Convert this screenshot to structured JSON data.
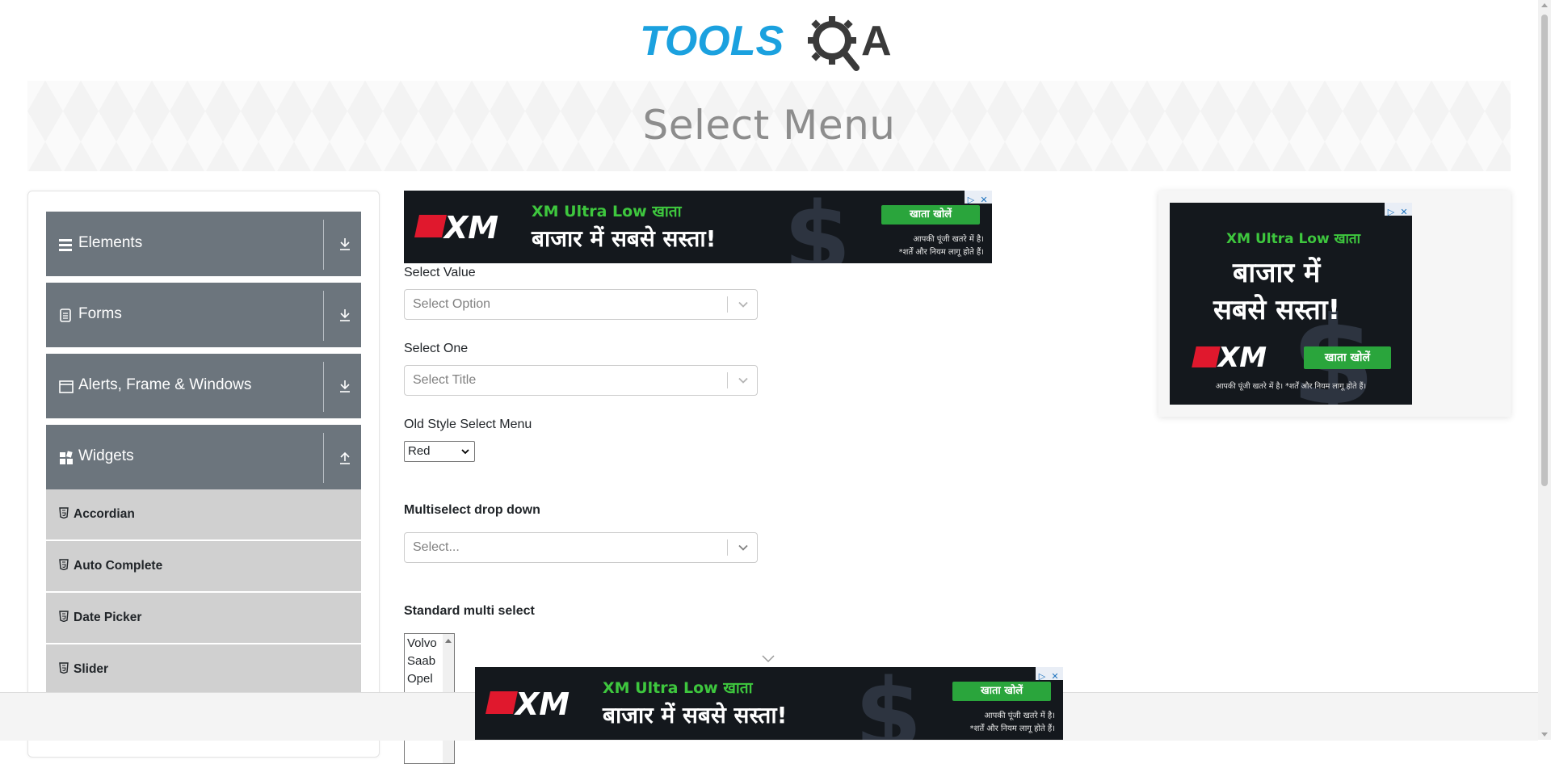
{
  "header": {
    "logo_text_left": "TOOLS",
    "logo_text_right": "A",
    "logo_icon": "gear-magnifier-q-icon"
  },
  "banner": {
    "title": "Select Menu"
  },
  "sidebar": {
    "groups": [
      {
        "label": "Elements",
        "icon": "hamburger-icon",
        "state": "collapsed"
      },
      {
        "label": "Forms",
        "icon": "form-icon",
        "state": "collapsed"
      },
      {
        "label": "Alerts, Frame & Windows",
        "icon": "window-icon",
        "state": "collapsed"
      },
      {
        "label": "Widgets",
        "icon": "widgets-icon",
        "state": "expanded"
      }
    ],
    "widget_items": [
      {
        "label": "Accordian"
      },
      {
        "label": "Auto Complete"
      },
      {
        "label": "Date Picker"
      },
      {
        "label": "Slider"
      }
    ]
  },
  "ads": {
    "brand": "XM",
    "headline": "XM Ultra Low खाता",
    "tagline": "बाजार में सबसे सस्ता!",
    "tagline_line1": "बाजार में",
    "tagline_line2": "सबसे सस्ता!",
    "cta": "खाता खोलें",
    "disclaimer1": "आपकी पूंजी खतरे में है।",
    "disclaimer2": "*शर्तें और नियम लागू होते हैं।",
    "disclaimer_single": "आपकी पूंजी खतरे में है। *शर्तें और नियम लागू होते हैं।",
    "chip_info": "▷",
    "chip_close": "✕"
  },
  "form": {
    "select_value": {
      "label": "Select Value",
      "placeholder": "Select Option"
    },
    "select_one": {
      "label": "Select One",
      "placeholder": "Select Title"
    },
    "old_style": {
      "label": "Old Style Select Menu",
      "selected": "Red"
    },
    "multiselect": {
      "label": "Multiselect drop down",
      "placeholder": "Select..."
    },
    "standard_multi": {
      "label": "Standard multi select",
      "options": [
        "Volvo",
        "Saab",
        "Opel"
      ]
    }
  }
}
